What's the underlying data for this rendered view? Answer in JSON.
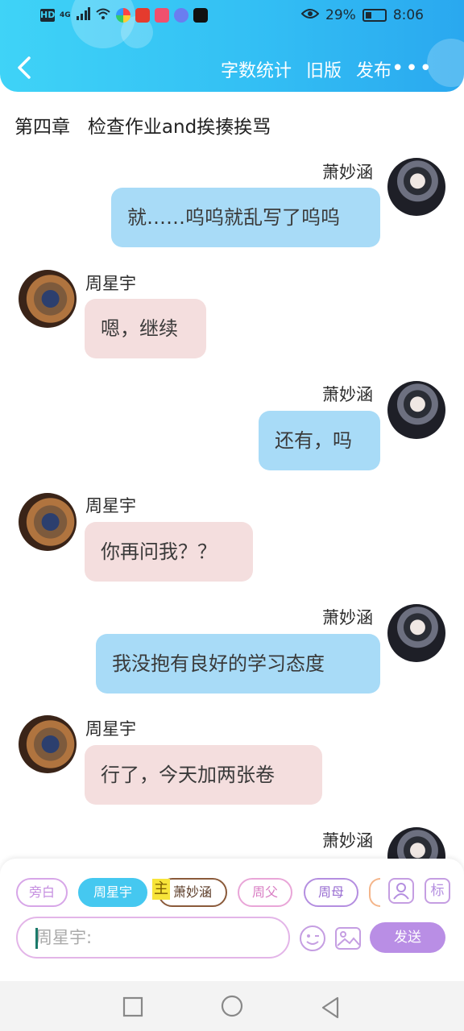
{
  "status_bar": {
    "hd_label": "HD",
    "network_label": "4G",
    "battery_percent": "29%",
    "time": "8:06"
  },
  "header": {
    "actions": [
      "字数统计",
      "旧版",
      "发布"
    ],
    "more_label": "•••",
    "accent_color": "#33bff4"
  },
  "chapter_title": "第四章   检查作业and挨揍挨骂",
  "messages": [
    {
      "side": "right",
      "speaker": "萧妙涵",
      "text": "就……呜呜就乱写了呜呜"
    },
    {
      "side": "left",
      "speaker": "周星宇",
      "text": "嗯，继续"
    },
    {
      "side": "right",
      "speaker": "萧妙涵",
      "text": "还有，吗"
    },
    {
      "side": "left",
      "speaker": "周星宇",
      "text": "你再问我？？"
    },
    {
      "side": "right",
      "speaker": "萧妙涵",
      "text": "我没抱有良好的学习态度"
    },
    {
      "side": "left",
      "speaker": "周星宇",
      "text": "行了，今天加两张卷"
    },
    {
      "side": "right",
      "speaker": "萧妙涵",
      "text": ""
    }
  ],
  "composer": {
    "roles": [
      "旁白",
      "周星宇",
      "萧妙涵",
      "周父",
      "周母"
    ],
    "active_role": "周星宇",
    "main_tag": "主",
    "mark_label": "标",
    "input_value": "周星宇:",
    "send_label": "发送"
  }
}
